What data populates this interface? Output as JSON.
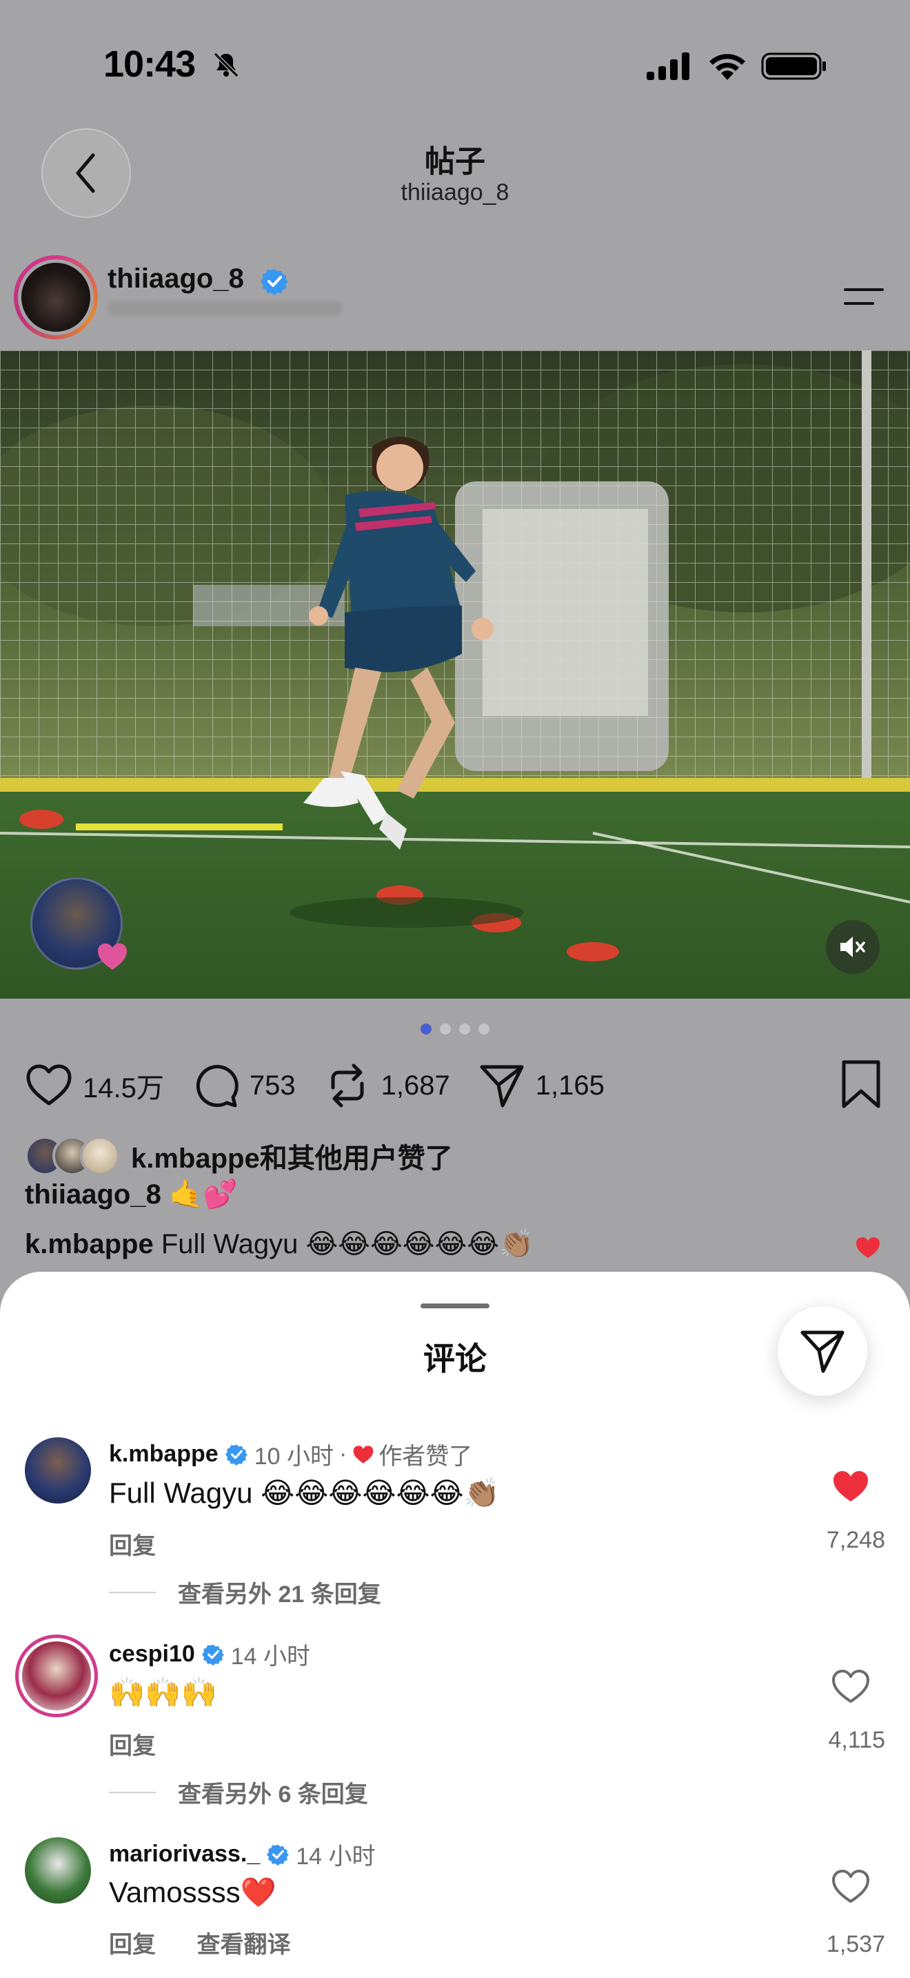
{
  "status_bar": {
    "time": "10:43"
  },
  "header": {
    "title": "帖子",
    "subtitle": "thiiaago_8"
  },
  "author": {
    "username": "thiiaago_8",
    "verified": true
  },
  "media": {
    "page_count": 4,
    "active_page": 1,
    "muted": true
  },
  "actions": {
    "likes": "14.5万",
    "comments": "753",
    "reposts": "1,687",
    "shares": "1,165"
  },
  "liked_by": {
    "text": "k.mbappe和其他用户赞了"
  },
  "caption": {
    "username": "thiiaago_8",
    "text": "🤙💕"
  },
  "top_comment": {
    "username": "k.mbappe",
    "text": "Full Wagyu 😂😂😂😂😂😂👏🏽"
  },
  "comments_sheet": {
    "title": "评论",
    "comments": [
      {
        "username": "k.mbappe",
        "time": "10 小时",
        "separator": "·",
        "author_liked": "作者赞了",
        "text": "Full Wagyu 😂😂😂😂😂😂👏🏽",
        "reply_label": "回复",
        "likes": "7,248",
        "liked": true,
        "more_replies": "查看另外 21 条回复"
      },
      {
        "username": "cespi10",
        "time": "14 小时",
        "text": "🙌🙌🙌",
        "reply_label": "回复",
        "likes": "4,115",
        "liked": false,
        "more_replies": "查看另外 6 条回复"
      },
      {
        "username": "mariorivass._",
        "time": "14 小时",
        "text": "Vamossss❤️",
        "reply_label": "回复",
        "translate_label": "查看翻译",
        "likes": "1,537",
        "liked": false
      }
    ]
  },
  "colors": {
    "accent_blue": "#3897f0",
    "like_red": "#ed2f3c",
    "dim_background": "#a4a4a6"
  }
}
